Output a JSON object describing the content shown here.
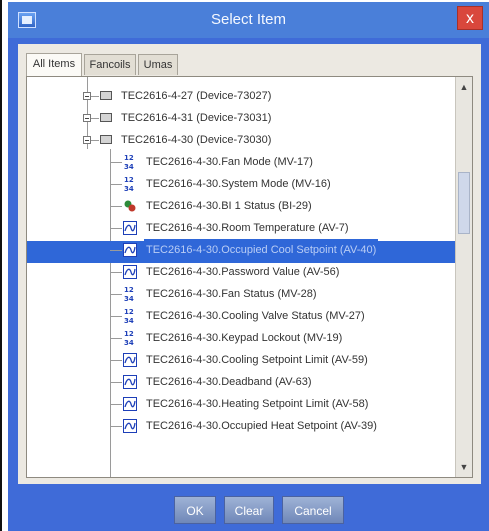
{
  "window": {
    "title": "Select Item",
    "close_label": "x"
  },
  "tabs": [
    "All Items",
    "Fancoils",
    "Umas"
  ],
  "tree": {
    "devices": [
      {
        "label": "TEC2616-4-27 (Device-73027)",
        "expanded": false
      },
      {
        "label": "TEC2616-4-31 (Device-73031)",
        "expanded": false
      },
      {
        "label": "TEC2616-4-30 (Device-73030)",
        "expanded": true
      }
    ],
    "points": [
      {
        "label": "TEC2616-4-30.Fan Mode (MV-17)",
        "icon": "multistate-value-icon"
      },
      {
        "label": "TEC2616-4-30.System Mode (MV-16)",
        "icon": "multistate-value-icon"
      },
      {
        "label": "TEC2616-4-30.BI 1 Status (BI-29)",
        "icon": "binary-input-icon"
      },
      {
        "label": "TEC2616-4-30.Room Temperature (AV-7)",
        "icon": "analog-value-icon"
      },
      {
        "label": "TEC2616-4-30.Occupied Cool Setpoint (AV-40)",
        "icon": "analog-value-icon",
        "selected": true
      },
      {
        "label": "TEC2616-4-30.Password Value (AV-56)",
        "icon": "analog-value-icon"
      },
      {
        "label": "TEC2616-4-30.Fan Status (MV-28)",
        "icon": "multistate-value-icon"
      },
      {
        "label": "TEC2616-4-30.Cooling Valve Status (MV-27)",
        "icon": "multistate-value-icon"
      },
      {
        "label": "TEC2616-4-30.Keypad Lockout (MV-19)",
        "icon": "multistate-value-icon"
      },
      {
        "label": "TEC2616-4-30.Cooling Setpoint Limit (AV-59)",
        "icon": "analog-value-icon"
      },
      {
        "label": "TEC2616-4-30.Deadband (AV-63)",
        "icon": "analog-value-icon"
      },
      {
        "label": "TEC2616-4-30.Heating Setpoint Limit (AV-58)",
        "icon": "analog-value-icon"
      },
      {
        "label": "TEC2616-4-30.Occupied Heat Setpoint (AV-39)",
        "icon": "analog-value-icon"
      }
    ]
  },
  "buttons": {
    "ok": "OK",
    "clear": "Clear",
    "cancel": "Cancel"
  },
  "colors": {
    "title_bar": "#4a7fd9",
    "selection": "#2f67d8",
    "close": "#d9473c"
  }
}
